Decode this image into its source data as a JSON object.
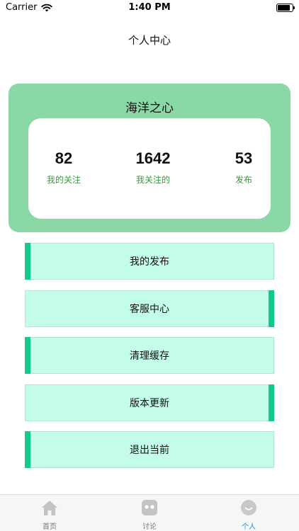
{
  "status_bar": {
    "carrier": "Carrier",
    "time": "1:40 PM",
    "battery_level": 0.95
  },
  "nav": {
    "title": "个人中心"
  },
  "profile": {
    "name": "海洋之心",
    "stats": [
      {
        "value": "82",
        "label": "我的关注"
      },
      {
        "value": "1642",
        "label": "我关注的"
      },
      {
        "value": "53",
        "label": "发布"
      }
    ]
  },
  "menu": [
    {
      "label": "我的发布",
      "accent": "left"
    },
    {
      "label": "客服中心",
      "accent": "right"
    },
    {
      "label": "清理缓存",
      "accent": "left"
    },
    {
      "label": "版本更新",
      "accent": "right"
    },
    {
      "label": "退出当前",
      "accent": "left"
    }
  ],
  "tabs": [
    {
      "label": "首页",
      "icon": "home-icon",
      "active": false
    },
    {
      "label": "讨论",
      "icon": "discuss-icon",
      "active": false
    },
    {
      "label": "个人",
      "icon": "profile-icon",
      "active": true
    }
  ],
  "colors": {
    "card_bg": "#8ad8a6",
    "button_bg": "#c3fde9",
    "accent": "#12c990",
    "stat_label": "#3a9a3a",
    "active_tab": "#1e8ad6"
  }
}
